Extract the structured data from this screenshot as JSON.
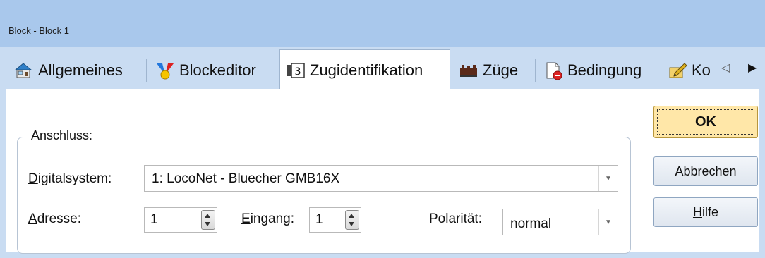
{
  "window": {
    "title": "Block - Block 1"
  },
  "tabs": [
    {
      "label": "Allgemeines",
      "icon": "house-icon"
    },
    {
      "label": "Blockeditor",
      "icon": "block-editor-icon"
    },
    {
      "label": "Zugidentifikation",
      "icon": "train-id-icon",
      "active": true
    },
    {
      "label": "Züge",
      "icon": "trains-icon"
    },
    {
      "label": "Bedingung",
      "icon": "condition-icon"
    },
    {
      "label": "Ko",
      "icon": "edit-icon"
    }
  ],
  "tab_nav": {
    "prev": "◁",
    "next": "▶"
  },
  "group": {
    "legend": "Anschluss:",
    "digitalsystem": {
      "label_ul": "D",
      "label_rest": "igitalsystem:",
      "value": "1: LocoNet - Bluecher GMB16X"
    },
    "adresse": {
      "label_ul": "A",
      "label_rest": "dresse:",
      "value": "1"
    },
    "eingang": {
      "label_ul": "E",
      "label_rest": "ingang:",
      "value": "1"
    },
    "polaritaet": {
      "label": "Polarität:",
      "value": "normal"
    }
  },
  "buttons": {
    "ok": "OK",
    "cancel": "Abbrechen",
    "help_ul": "H",
    "help_rest": "ilfe"
  },
  "colors": {
    "accent": "#a9c8ec",
    "tab_background": "#c9dcf2",
    "default_button": "#ffe7a8"
  }
}
